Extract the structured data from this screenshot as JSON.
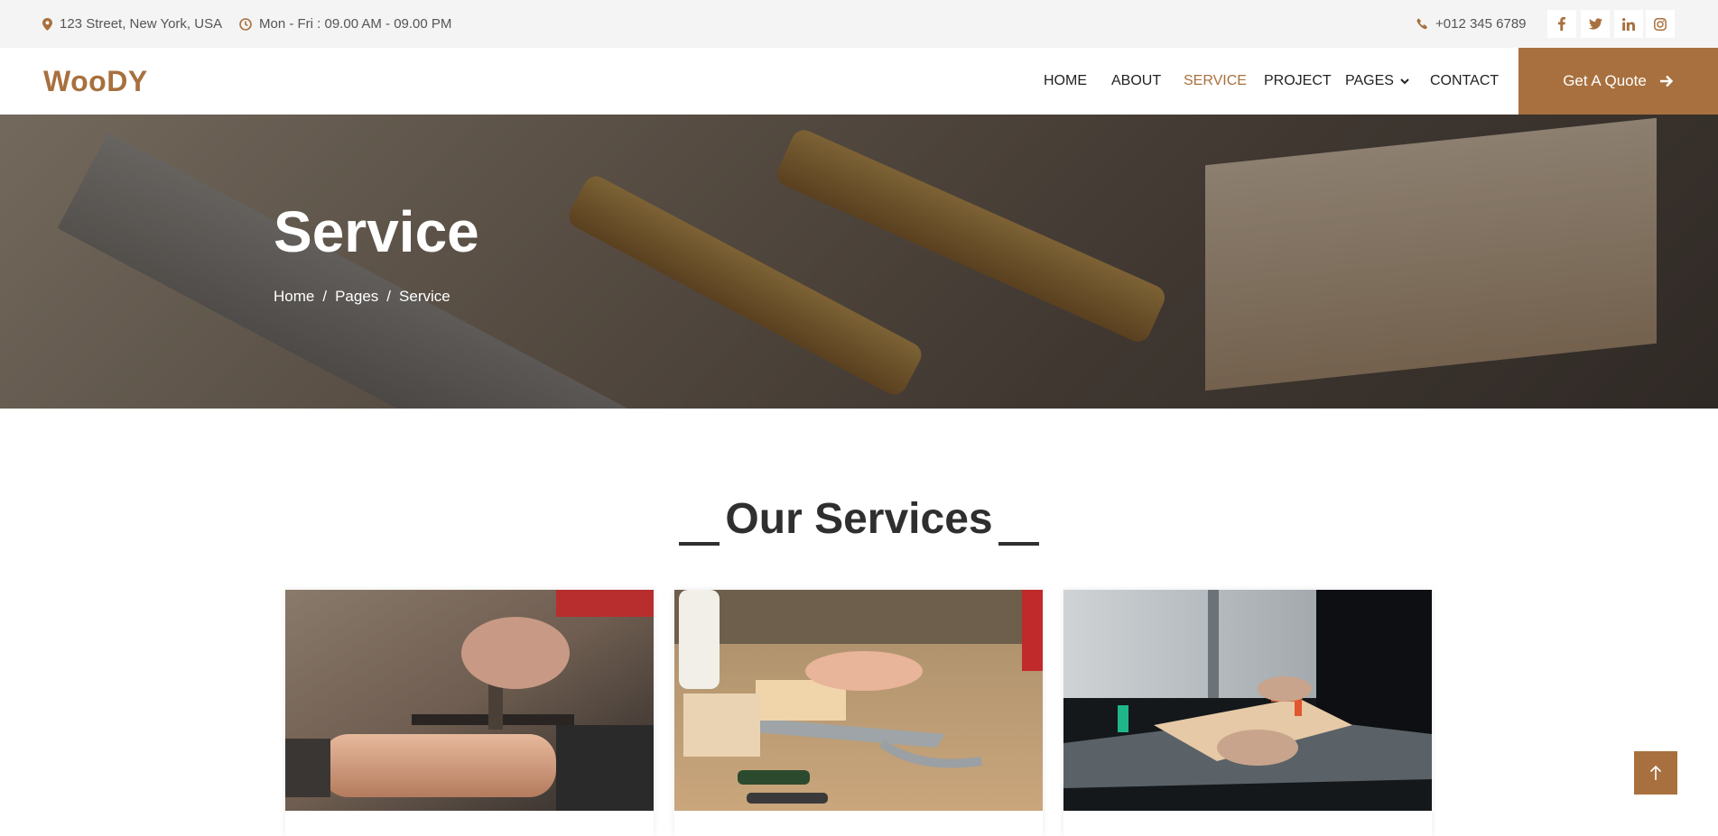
{
  "topbar": {
    "address": "123 Street, New York, USA",
    "hours": "Mon - Fri : 09.00 AM - 09.00 PM",
    "phone": "+012 345 6789",
    "social": [
      "facebook-icon",
      "twitter-icon",
      "linkedin-icon",
      "instagram-icon"
    ]
  },
  "navbar": {
    "brand": "WooDY",
    "links": [
      {
        "label": "HOME",
        "active": false
      },
      {
        "label": "ABOUT",
        "active": false
      },
      {
        "label": "SERVICE",
        "active": true
      },
      {
        "label": "PROJECT",
        "active": false
      },
      {
        "label": "PAGES",
        "active": false,
        "dropdown": true
      },
      {
        "label": "CONTACT",
        "active": false
      }
    ],
    "cta": "Get A Quote"
  },
  "hero": {
    "title": "Service",
    "breadcrumb": [
      "Home",
      "Pages",
      "Service"
    ],
    "separator": "/"
  },
  "services": {
    "title": "Our Services"
  },
  "colors": {
    "accent": "#a8703e",
    "topbar_bg": "#f4f4f4",
    "heading": "#2f2f2f"
  }
}
